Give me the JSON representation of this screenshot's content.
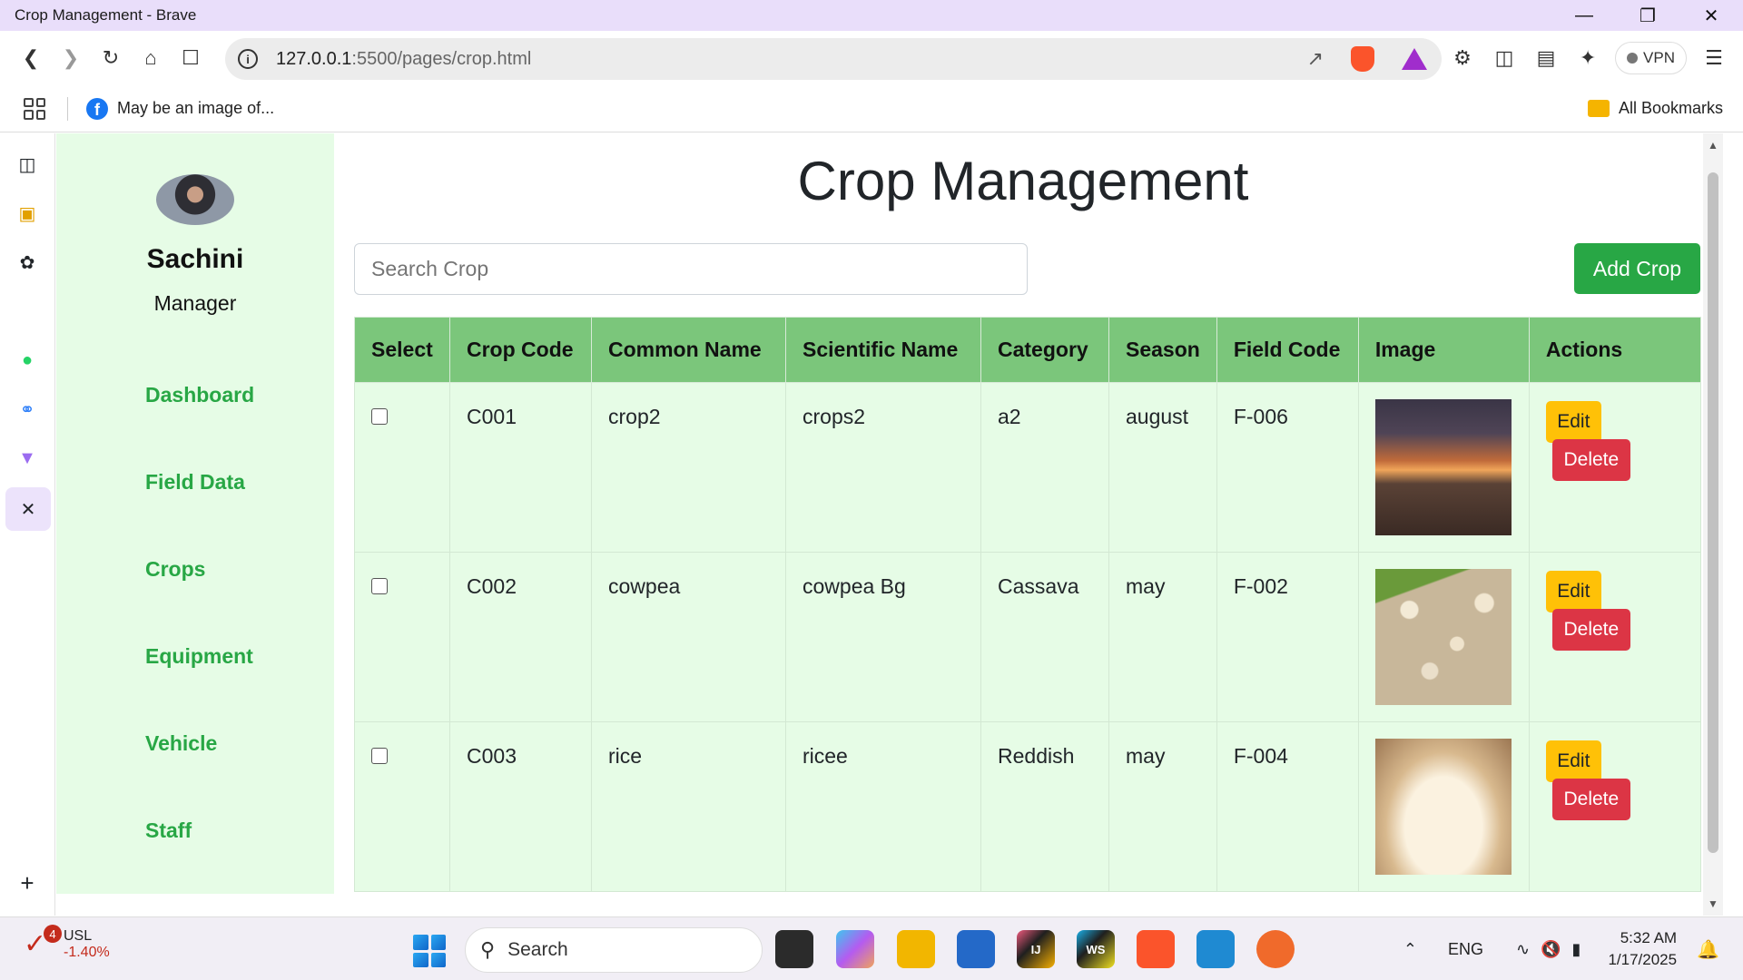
{
  "browser": {
    "window_title": "Crop Management - Brave",
    "url_host": "127.0.0.1",
    "url_path": ":5500/pages/crop.html",
    "vpn_label": "VPN",
    "bookmark_item": "May be an image of...",
    "all_bookmarks": "All Bookmarks"
  },
  "profile": {
    "name": "Sachini",
    "role": "Manager"
  },
  "nav": [
    "Dashboard",
    "Field Data",
    "Crops",
    "Equipment",
    "Vehicle",
    "Staff"
  ],
  "main": {
    "title": "Crop Management",
    "search_placeholder": "Search Crop",
    "add_button": "Add Crop"
  },
  "table": {
    "headers": [
      "Select",
      "Crop Code",
      "Common Name",
      "Scientific Name",
      "Category",
      "Season",
      "Field Code",
      "Image",
      "Actions"
    ],
    "rows": [
      {
        "code": "C001",
        "common": "crop2",
        "scientific": "crops2",
        "category": "a2",
        "season": "august",
        "field": "F-006",
        "image": "sunset-photo"
      },
      {
        "code": "C002",
        "common": "cowpea",
        "scientific": "cowpea Bg",
        "category": "Cassava",
        "season": "may",
        "field": "F-002",
        "image": "cowpea-beans-photo"
      },
      {
        "code": "C003",
        "common": "rice",
        "scientific": "ricee",
        "category": "Reddish",
        "season": "may",
        "field": "F-004",
        "image": "rice-grains-photo"
      }
    ],
    "edit_label": "Edit",
    "delete_label": "Delete"
  },
  "taskbar": {
    "stock_name": "USL",
    "stock_change": "-1.40%",
    "stock_badge": "4",
    "search_label": "Search",
    "lang": "ENG",
    "time": "5:32 AM",
    "date": "1/17/2025"
  },
  "colors": {
    "accent_green": "#28a745",
    "sidebar_bg": "#e6fce6",
    "header_green": "#7bc67b",
    "edit_yellow": "#ffc107",
    "delete_red": "#dc3545"
  }
}
